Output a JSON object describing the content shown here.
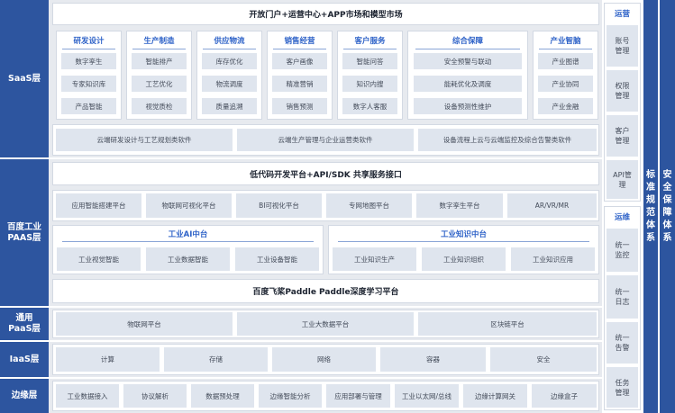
{
  "layers": {
    "saas": "SaaS层",
    "paas_line1": "百度工业",
    "paas_line2": "PAAS层",
    "gen_line1": "通用",
    "gen_line2": "PaaS层",
    "iaas": "IaaS层",
    "edge": "边缘层"
  },
  "saas": {
    "banner": "开放门户+运营中心+APP市场和模型市场",
    "categories": [
      {
        "title": "研发设计",
        "items": [
          "数字孪生",
          "专家知识库",
          "产品智能"
        ]
      },
      {
        "title": "生产制造",
        "items": [
          "智能排产",
          "工艺优化",
          "视觉质检"
        ]
      },
      {
        "title": "供应物流",
        "items": [
          "库存优化",
          "物流调度",
          "质量追溯"
        ]
      },
      {
        "title": "销售经营",
        "items": [
          "客户画像",
          "精准营销",
          "销售预测"
        ]
      },
      {
        "title": "客户服务",
        "items": [
          "智能问答",
          "知识内搜",
          "数字人客服"
        ]
      },
      {
        "title": "综合保障",
        "items": [
          "安全预警与联动",
          "能耗优化及调度",
          "设备预测性维护"
        ]
      },
      {
        "title": "产业智脑",
        "items": [
          "产业图谱",
          "产业协同",
          "产业金融"
        ]
      }
    ],
    "cloud": [
      "云端研发设计与工艺规划类软件",
      "云端生产管理与企业运营类软件",
      "设备流程上云与云端监控及综合告警类软件"
    ]
  },
  "paas": {
    "lowcode_banner": "低代码开发平台+API/SDK 共享服务接口",
    "platforms": [
      "应用智能搭建平台",
      "物联网可视化平台",
      "BI可视化平台",
      "专网地图平台",
      "数字孪生平台",
      "AR/VR/MR"
    ],
    "ai_title": "工业AI中台",
    "ai_items": [
      "工业视觉智能",
      "工业数据智能",
      "工业设备智能"
    ],
    "kg_title": "工业知识中台",
    "kg_items": [
      "工业知识生产",
      "工业知识组织",
      "工业知识应用"
    ],
    "paddle_banner": "百度飞桨Paddle Paddle深度学习平台"
  },
  "general_paas": [
    "物联网平台",
    "工业大数据平台",
    "区块链平台"
  ],
  "iaas": [
    "计算",
    "存储",
    "网络",
    "容器",
    "安全"
  ],
  "edge": [
    "工业数据接入",
    "协议解析",
    "数据预处理",
    "边缘智能分析",
    "应用部署与管理",
    "工业以太网/总线",
    "边缘计算网关",
    "边缘盒子"
  ],
  "ops": {
    "title": "运营",
    "items": [
      "账号管理",
      "权限管理",
      "客户管理",
      "API管理"
    ]
  },
  "maint": {
    "title": "运维",
    "items": [
      "统一监控",
      "统一日志",
      "统一告警",
      "任务管理"
    ]
  },
  "standards": "标准规范体系",
  "security": "安全保障体系",
  "colors": {
    "accent": "#2d559f",
    "title_blue": "#2f63c8",
    "cell": "#dfe5ee",
    "layer_bg": "#e7eaef"
  }
}
